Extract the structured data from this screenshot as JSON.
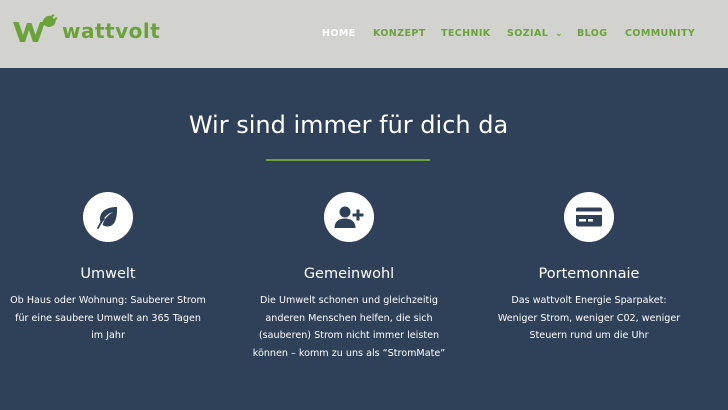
{
  "brand": {
    "name": "wattvolt",
    "color": "#6aa339"
  },
  "nav": {
    "items": [
      {
        "label": "HOME",
        "active": true
      },
      {
        "label": "KONZEPT",
        "active": false
      },
      {
        "label": "TECHNIK",
        "active": false
      },
      {
        "label": "SOZIAL",
        "active": false,
        "dropdown": true
      },
      {
        "label": "BLOG",
        "active": false
      },
      {
        "label": "COMMUNITY",
        "active": false
      }
    ]
  },
  "section": {
    "heading": "Wir sind immer für dich da",
    "background": "#2f4059",
    "accent": "#6aa339"
  },
  "features": [
    {
      "icon": "leaf-icon",
      "title": "Umwelt",
      "lines": [
        "Ob Haus oder Wohnung: Sauberer Strom",
        "für eine saubere Umwelt an 365 Tagen",
        "im Jahr"
      ]
    },
    {
      "icon": "user-plus-icon",
      "title": "Gemeinwohl",
      "lines": [
        "Die Umwelt schonen und gleichzeitig",
        "anderen Menschen helfen, die sich",
        "(sauberen) Strom nicht immer leisten",
        "können – komm zu uns als “StromMate”"
      ]
    },
    {
      "icon": "credit-card-icon",
      "title": "Portemonnaie",
      "lines": [
        "Das wattvolt Energie Sparpaket:",
        "Weniger Strom, weniger C02, weniger",
        "Steuern rund um die Uhr"
      ]
    }
  ]
}
